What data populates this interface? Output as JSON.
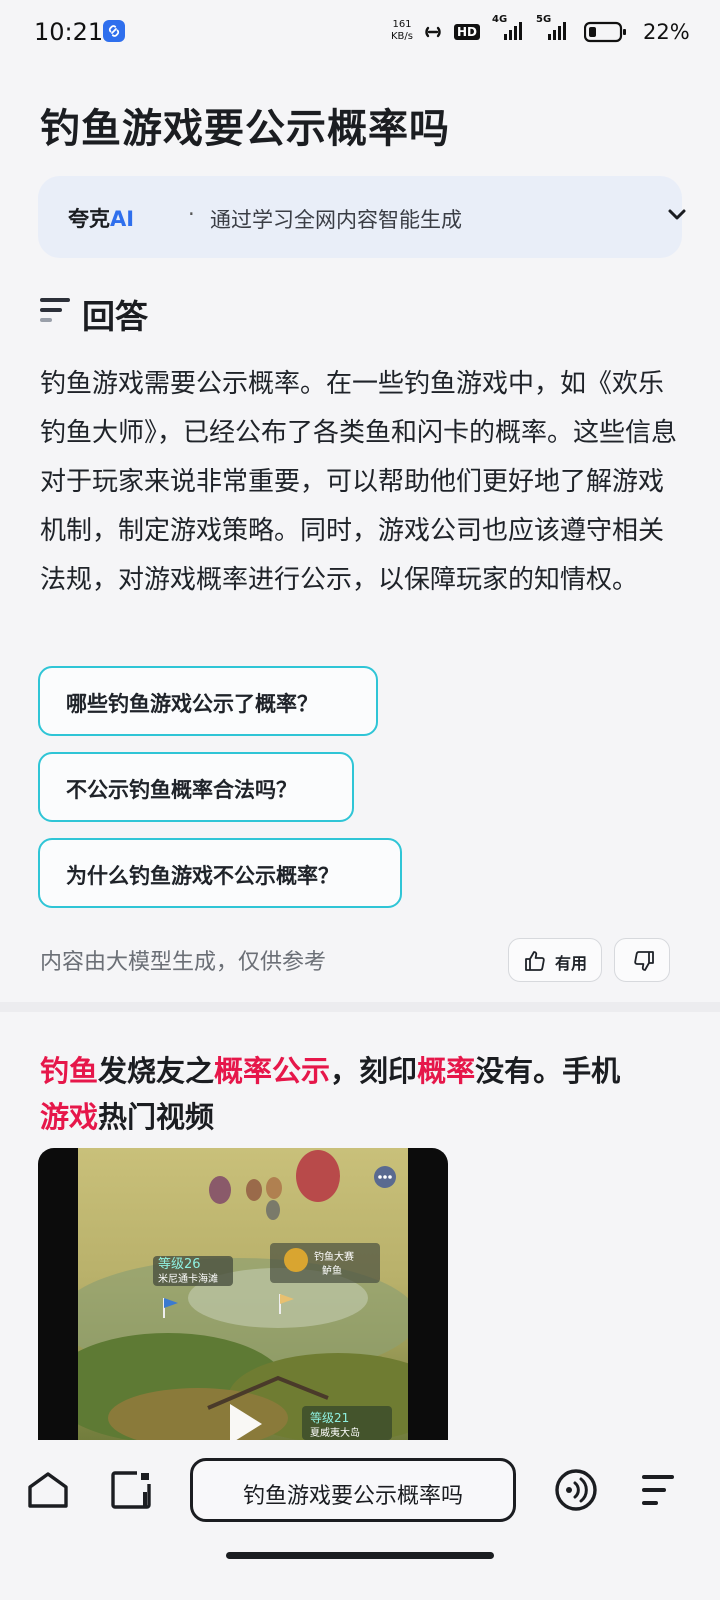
{
  "status": {
    "time": "10:21",
    "speed_value": "161",
    "speed_unit": "KB/s",
    "hd_label": "HD",
    "net1": "4G",
    "net2": "5G",
    "battery": "22%"
  },
  "page": {
    "title": "钓鱼游戏要公示概率吗"
  },
  "ai_bar": {
    "brand_prefix": "夸克",
    "brand_ai": "AI",
    "separator": "·",
    "description": "通过学习全网内容智能生成"
  },
  "answer": {
    "heading": "回答",
    "text": "钓鱼游戏需要公示概率。在一些钓鱼游戏中，如《欢乐钓鱼大师》，已经公布了各类鱼和闪卡的概率。这些信息对于玩家来说非常重要，可以帮助他们更好地了解游戏机制，制定游戏策略。同时，游戏公司也应该遵守相关法规，对游戏概率进行公示，以保障玩家的知情权。"
  },
  "suggestions": [
    "哪些钓鱼游戏公示了概率？",
    "不公示钓鱼概率合法吗？",
    "为什么钓鱼游戏不公示概率？"
  ],
  "feedback": {
    "disclaimer": "内容由大模型生成，仅供参考",
    "like_label": "有用"
  },
  "result": {
    "title_parts": [
      "钓鱼",
      "发烧友之",
      "概率公示",
      "，刻印",
      "概率",
      "没有。手机",
      "游戏",
      "热门视频"
    ],
    "video_labels": {
      "level26": "等级26",
      "place26": "米尼通卡海滩",
      "contest_1": "钓鱼大赛",
      "contest_2": "鲈鱼",
      "level21": "等级21",
      "place21": "夏威夷大岛"
    }
  },
  "bottom_bar": {
    "search_text": "钓鱼游戏要公示概率吗"
  },
  "colors": {
    "accent": "#2f6fed",
    "highlight": "#e6174a",
    "chip_border": "#2fc5d6"
  }
}
